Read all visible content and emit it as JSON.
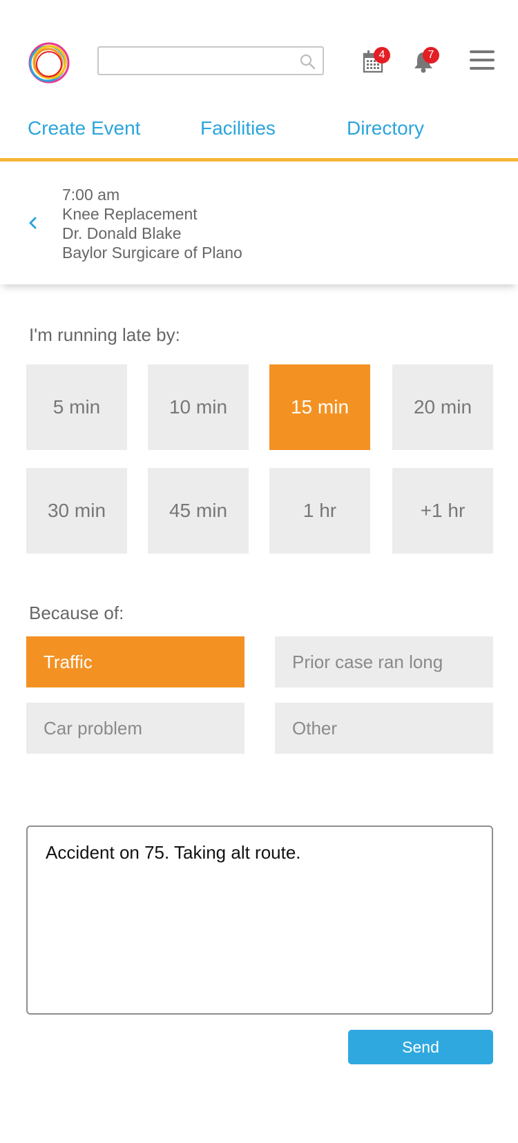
{
  "header": {
    "search": {
      "value": "",
      "placeholder": ""
    },
    "calendar_badge": "4",
    "notifications_badge": "7",
    "colors": {
      "accent": "#2aa5dc",
      "nav_underline": "#f4b73a",
      "selected": "#f39223",
      "badge": "#e31e24"
    },
    "icons": [
      "logo-ring",
      "search-icon",
      "calendar-icon",
      "bell-icon",
      "hamburger-menu-icon"
    ]
  },
  "nav": {
    "tabs": [
      {
        "label": "Create Event"
      },
      {
        "label": "Facilities"
      },
      {
        "label": "Directory"
      }
    ]
  },
  "event": {
    "time": "7:00 am",
    "procedure": "Knee Replacement",
    "doctor": "Dr. Donald Blake",
    "facility": "Baylor Surgicare of Plano"
  },
  "late": {
    "label": "I'm running late by:",
    "options": [
      {
        "label": "5 min",
        "selected": false
      },
      {
        "label": "10 min",
        "selected": false
      },
      {
        "label": "15 min",
        "selected": true
      },
      {
        "label": "20 min",
        "selected": false
      },
      {
        "label": "30 min",
        "selected": false
      },
      {
        "label": "45 min",
        "selected": false
      },
      {
        "label": "1 hr",
        "selected": false
      },
      {
        "label": "+1 hr",
        "selected": false
      }
    ]
  },
  "reason": {
    "label": "Because of:",
    "options": [
      {
        "label": "Traffic",
        "selected": true
      },
      {
        "label": "Prior case ran long",
        "selected": false
      },
      {
        "label": "Car problem",
        "selected": false
      },
      {
        "label": "Other",
        "selected": false
      }
    ]
  },
  "message": {
    "value": "Accident on 75. Taking alt route."
  },
  "send_label": "Send"
}
